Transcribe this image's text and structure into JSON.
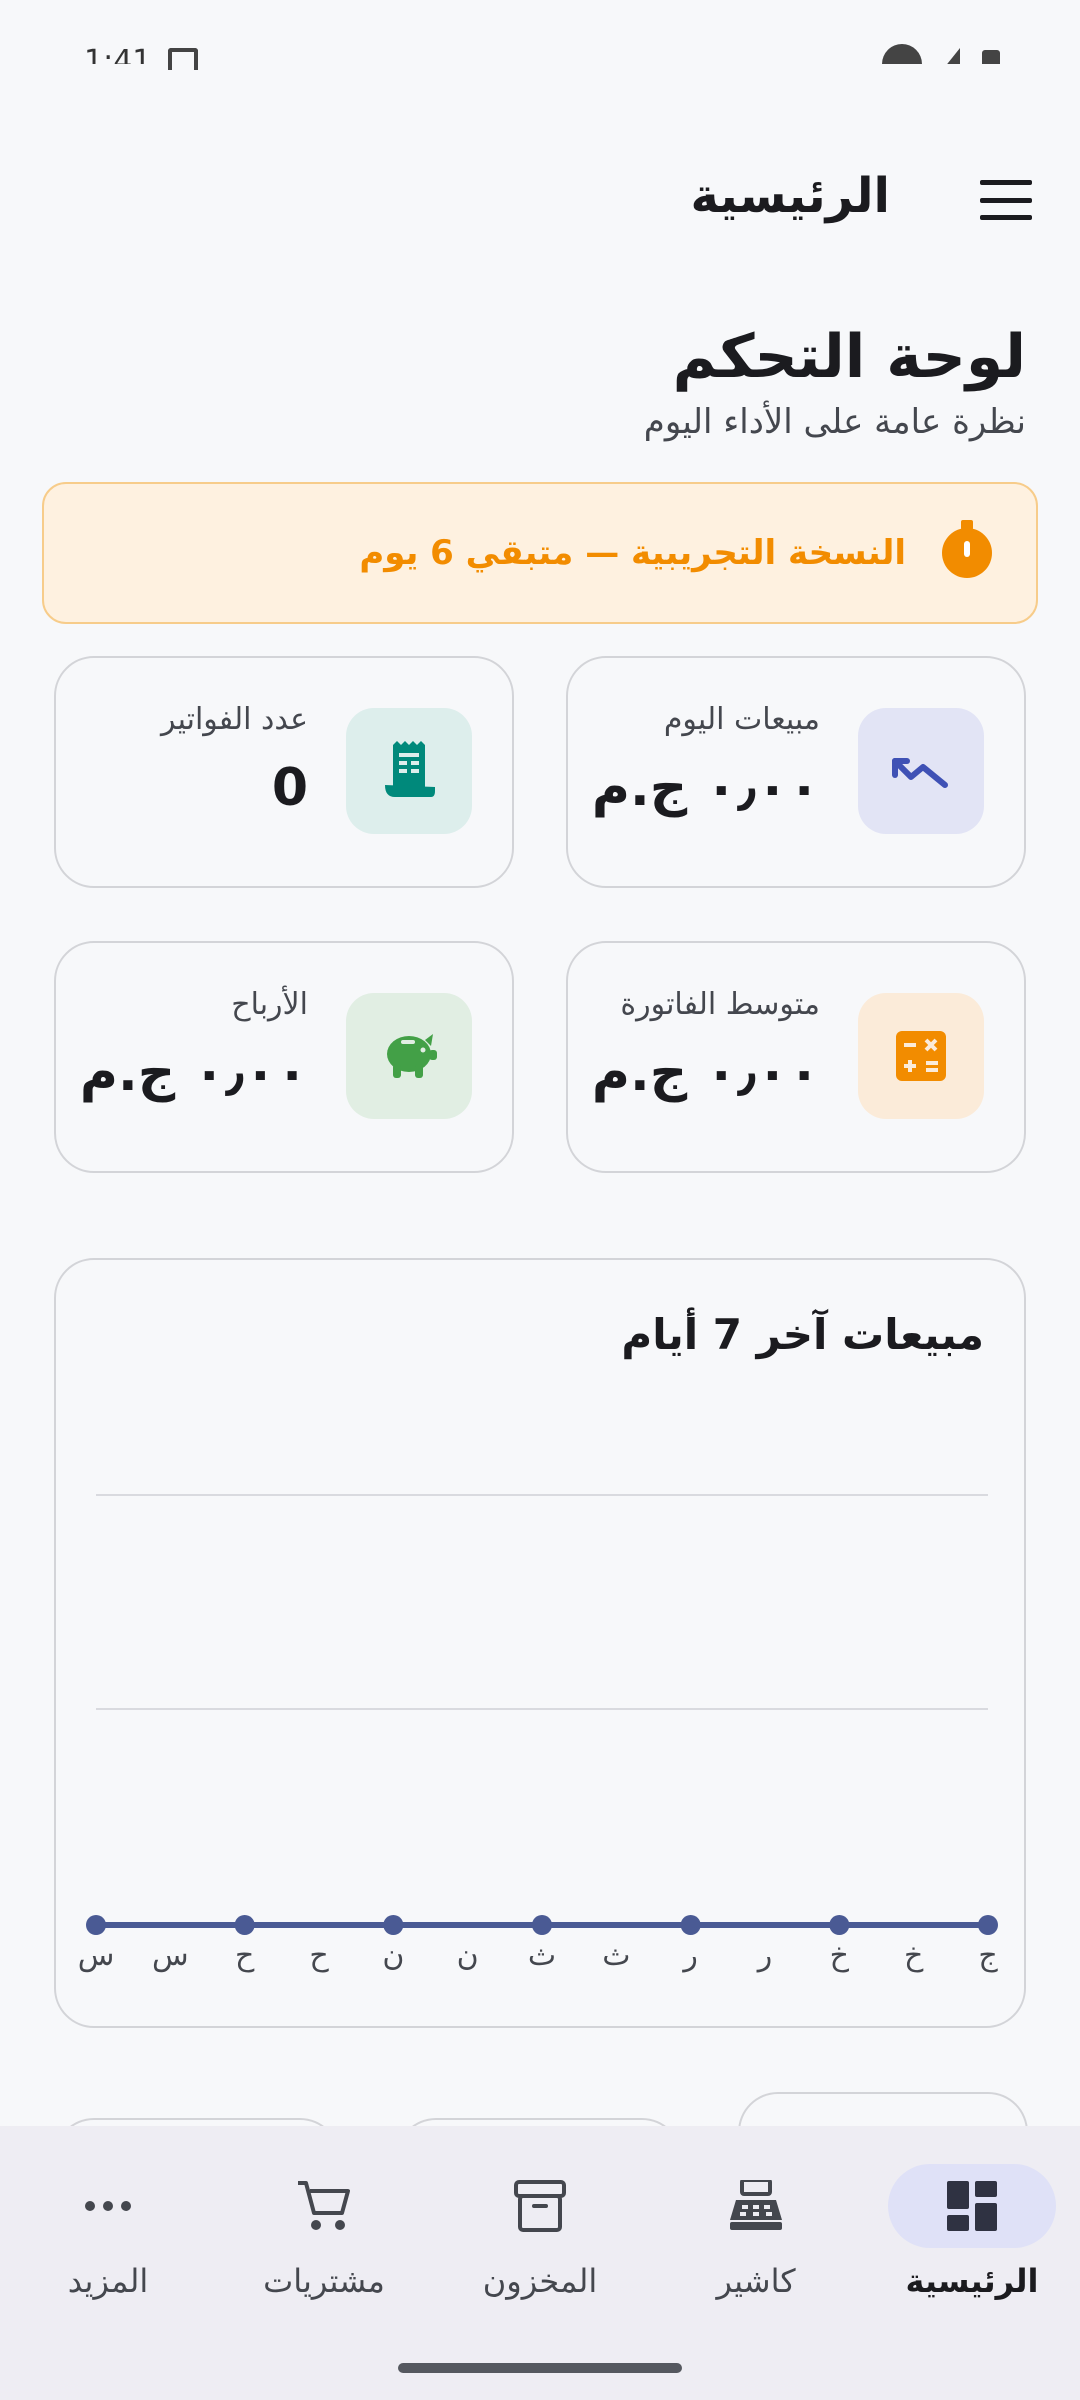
{
  "status_bar": {
    "time": "1:41"
  },
  "app_bar": {
    "title": "الرئيسية"
  },
  "header": {
    "title": "لوحة التحكم",
    "subtitle": "نظرة عامة على الأداء اليوم"
  },
  "trial_banner": {
    "text": "النسخة التجريبية — متبقي 6 يوم",
    "color": "#F28C00"
  },
  "stats": {
    "today_sales": {
      "label": "مبيعات اليوم",
      "value": "٠٫٠٠ ج.م",
      "icon": "trending-up-icon",
      "icon_bg": "#E2E4F5",
      "icon_color": "#3F51B5"
    },
    "invoice_count": {
      "label": "عدد الفواتير",
      "value": "0",
      "icon": "receipt-icon",
      "icon_bg": "#DDEEEC",
      "icon_color": "#00897B"
    },
    "avg_invoice": {
      "label": "متوسط الفاتورة",
      "value": "٠٫٠٠ ج.م",
      "icon": "calculator-icon",
      "icon_bg": "#FBEBD9",
      "icon_color": "#F28C00"
    },
    "profits": {
      "label": "الأرباح",
      "value": "٠٫٠٠ ج.م",
      "icon": "piggy-bank-icon",
      "icon_bg": "#E1EEE3",
      "icon_color": "#43A047"
    }
  },
  "chart_data": {
    "type": "line",
    "title": "مبيعات آخر 7 أيام",
    "x": [
      "ج",
      "خ",
      "خ",
      "ر",
      "ر",
      "ث",
      "ث",
      "ن",
      "ن",
      "ح",
      "ح",
      "س",
      "س"
    ],
    "point_labels": [
      "ج",
      "خ",
      "ر",
      "ث",
      "ن",
      "ح",
      "س"
    ],
    "series": [
      {
        "values": [
          0,
          0,
          0,
          0,
          0,
          0,
          0
        ],
        "color": "#4A5A94"
      }
    ],
    "gridlines": 2,
    "grid": true
  },
  "bottom_nav": [
    {
      "label": "الرئيسية",
      "icon": "dashboard-icon",
      "active": true
    },
    {
      "label": "كاشير",
      "icon": "cash-register-icon",
      "active": false
    },
    {
      "label": "المخزون",
      "icon": "inventory-box-icon",
      "active": false
    },
    {
      "label": "مشتريات",
      "icon": "cart-icon",
      "active": false
    },
    {
      "label": "المزيد",
      "icon": "more-horiz-icon",
      "active": false
    }
  ]
}
